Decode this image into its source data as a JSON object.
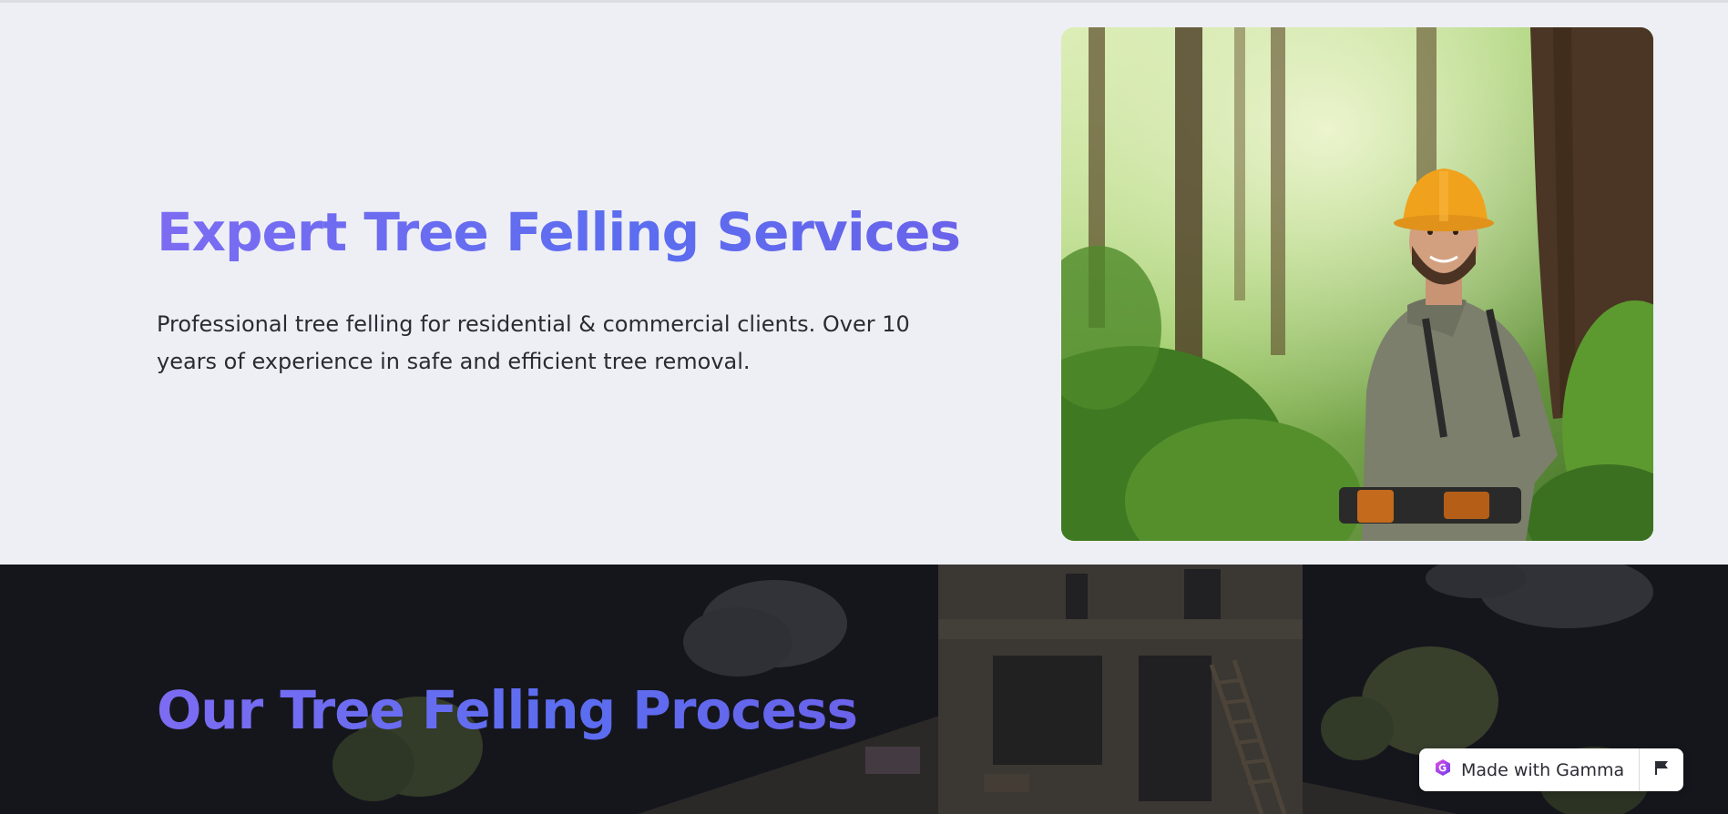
{
  "hero": {
    "title": "Expert Tree Felling Services",
    "description": "Professional tree felling for residential & commercial clients. Over 10 years of experience in safe and efficient tree removal."
  },
  "process": {
    "title": "Our Tree Felling Process"
  },
  "badge": {
    "label": "Made with Gamma",
    "icon": "gamma-logo-icon",
    "flag_icon": "flag-icon"
  },
  "colors": {
    "title_gradient_start": "#7c6cf2",
    "title_gradient_end": "#5b6df0",
    "hero_background": "#eeeff4",
    "process_background": "#15161c"
  }
}
